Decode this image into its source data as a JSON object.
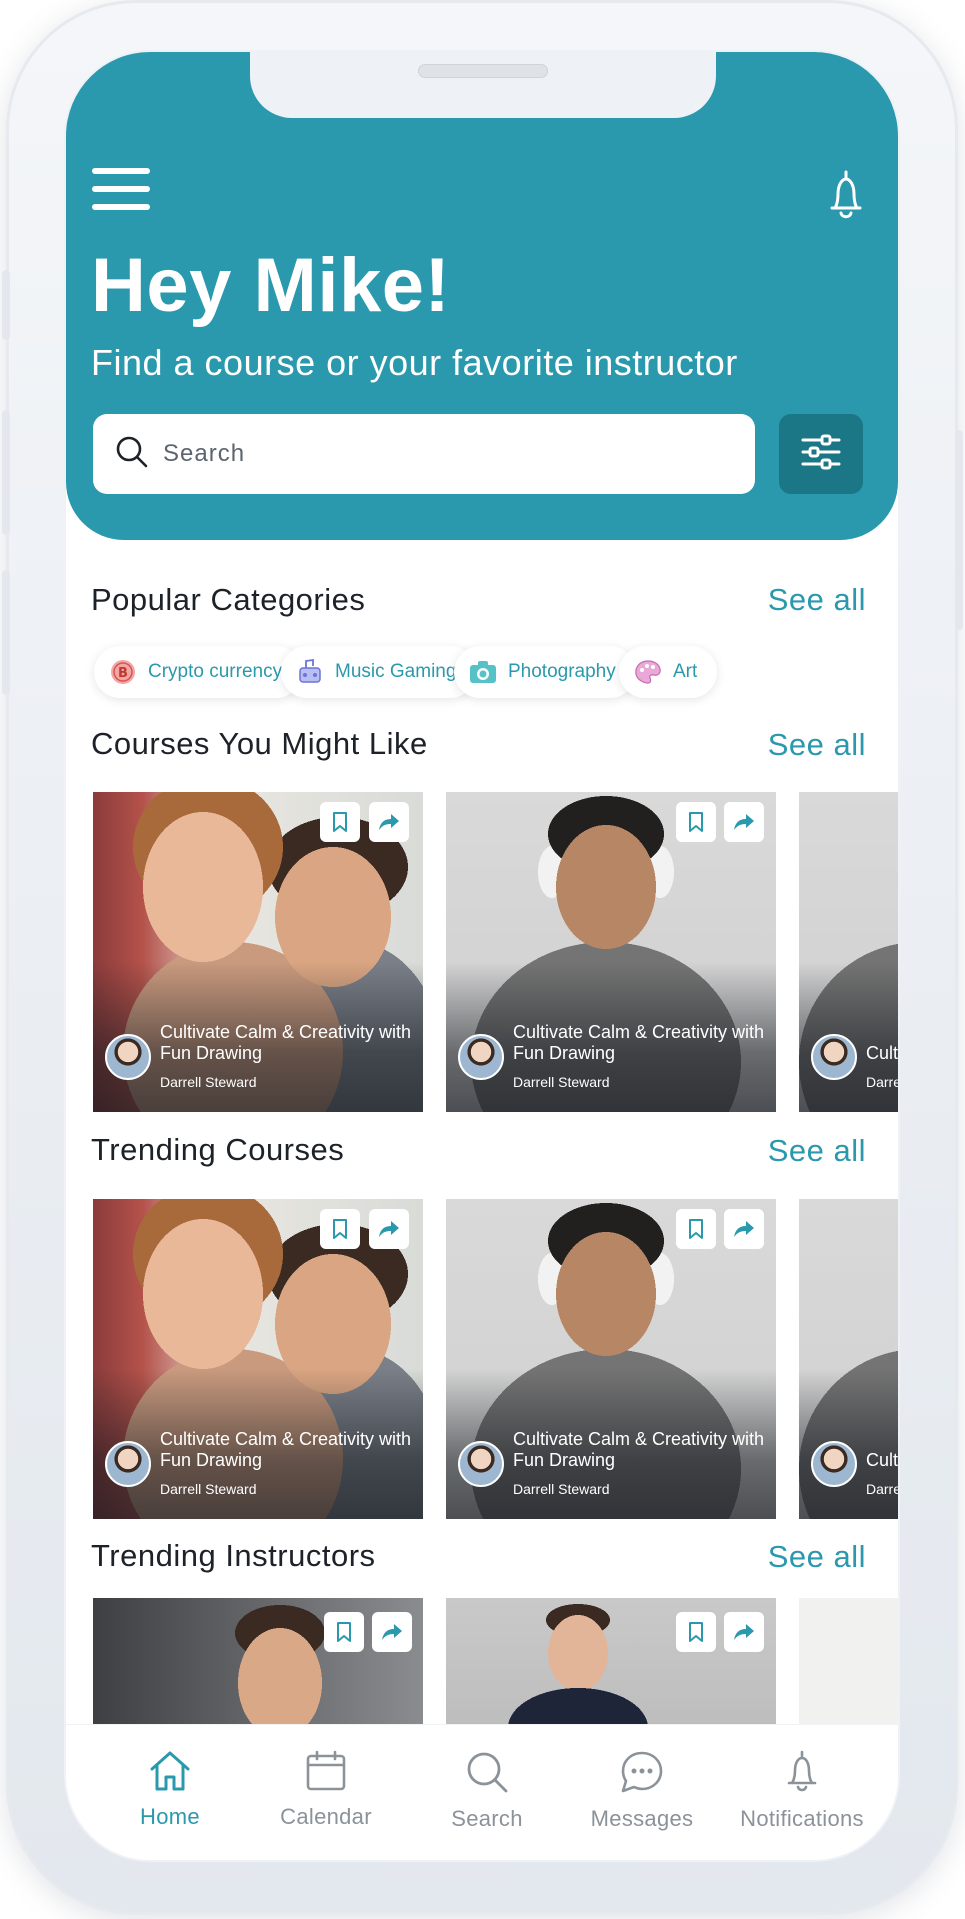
{
  "header": {
    "greeting": "Hey Mike!",
    "subtitle": "Find a course or your favorite instructor",
    "search_placeholder": "Search"
  },
  "popular_categories": {
    "title": "Popular Categories",
    "see_all": "See all",
    "chips": [
      {
        "label": "Crypto currency",
        "icon": "bitcoin-icon"
      },
      {
        "label": "Music Gaming",
        "icon": "music-gaming-icon"
      },
      {
        "label": "Photography",
        "icon": "camera-icon"
      },
      {
        "label": "Art",
        "icon": "palette-icon"
      }
    ]
  },
  "courses_you_might_like": {
    "title": "Courses You Might Like",
    "see_all": "See all",
    "cards": [
      {
        "title": "Cultivate Calm & Creativity with Fun Drawing",
        "author": "Darrell Steward"
      },
      {
        "title": "Cultivate Calm & Creativity with Fun Drawing",
        "author": "Darrell Steward"
      },
      {
        "title": "Cultivate Calm & Creativity with Fun Drawing",
        "author": "Darrell Steward"
      }
    ]
  },
  "trending_courses": {
    "title": "Trending Courses",
    "see_all": "See all",
    "cards": [
      {
        "title": "Cultivate Calm & Creativity with Fun Drawing",
        "author": "Darrell Steward"
      },
      {
        "title": "Cultivate Calm & Creativity with Fun Drawing",
        "author": "Darrell Steward"
      },
      {
        "title": "Cultivate Calm & Creativity with Fun Drawing",
        "author": "Darrell Steward"
      }
    ]
  },
  "trending_instructors": {
    "title": "Trending Instructors",
    "see_all": "See all"
  },
  "tabbar": {
    "items": [
      {
        "label": "Home",
        "icon": "home-icon",
        "active": true
      },
      {
        "label": "Calendar",
        "icon": "calendar-icon",
        "active": false
      },
      {
        "label": "Search",
        "icon": "search-icon",
        "active": false
      },
      {
        "label": "Messages",
        "icon": "chat-bubble-icon",
        "active": false
      },
      {
        "label": "Notifications",
        "icon": "bell-icon",
        "active": false
      }
    ]
  },
  "colors": {
    "primary": "#2b99ad",
    "primary_dark": "#1b7686",
    "text": "#1d2229",
    "tab_inactive": "#8b9299"
  }
}
